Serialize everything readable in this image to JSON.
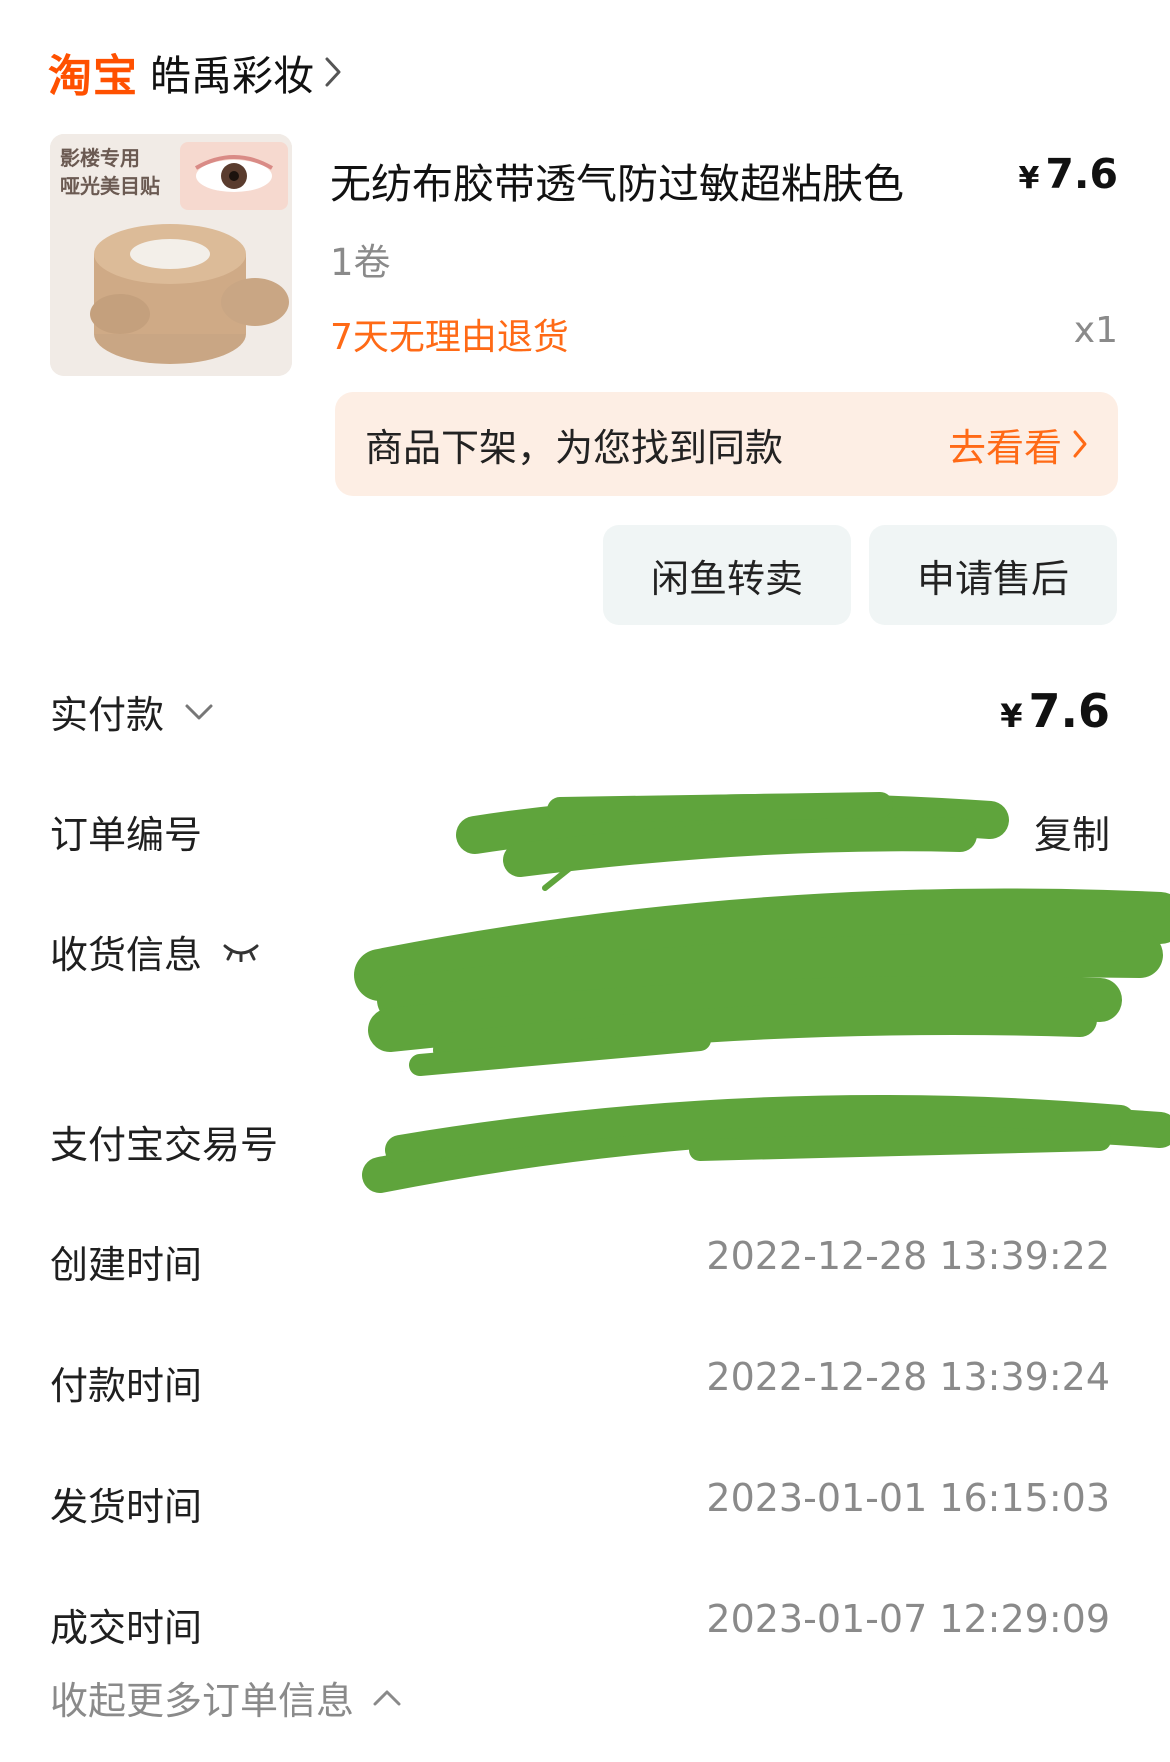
{
  "shop": {
    "platform_logo": "淘宝",
    "name": "皓禹彩妆"
  },
  "product": {
    "thumbnail_text_line1": "影楼专用",
    "thumbnail_text_line2": "哑光美目贴",
    "title": "无纺布胶带透气防过敏超粘肤色",
    "price_symbol": "¥",
    "price": "7.6",
    "spec": "1卷",
    "return_policy": "7天无理由退货",
    "quantity": "x1"
  },
  "banner": {
    "text": "商品下架，为您找到同款",
    "link_label": "去看看"
  },
  "actions": {
    "xianyu_label": "闲鱼转卖",
    "aftersale_label": "申请售后"
  },
  "order": {
    "paid_label": "实付款",
    "paid_symbol": "¥",
    "paid_amount": "7.6",
    "order_no_label": "订单编号",
    "copy_label": "复制",
    "shipping_label": "收货信息",
    "alipay_label": "支付宝交易号",
    "created_label": "创建时间",
    "created_value": "2022-12-28 13:39:22",
    "paid_time_label": "付款时间",
    "paid_time_value": "2022-12-28 13:39:24",
    "shipped_label": "发货时间",
    "shipped_value": "2023-01-01 16:15:03",
    "completed_label": "成交时间",
    "completed_value": "2023-01-07 12:29:09",
    "collapse_label": "收起更多订单信息"
  },
  "colors": {
    "accent": "#ff5000",
    "orange_text": "#ff6a16",
    "banner_bg": "#fdeee4",
    "button_bg": "#f0f5f5",
    "redaction_green": "#5fa43c"
  }
}
